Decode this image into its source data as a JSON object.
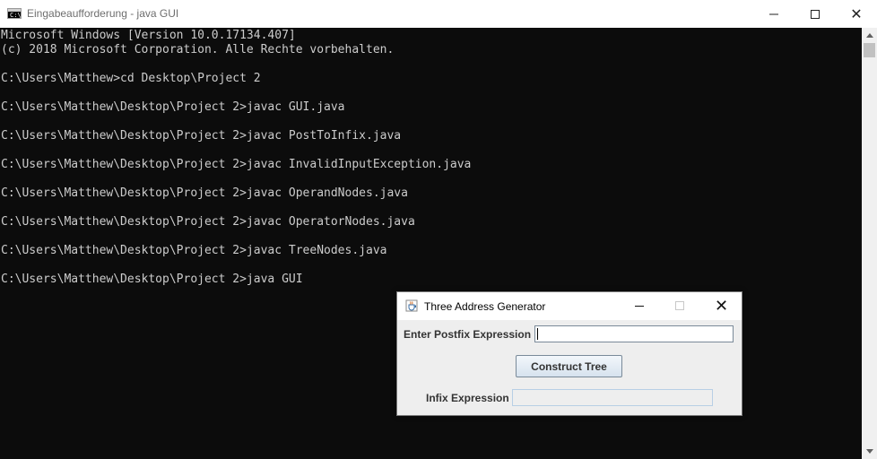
{
  "console_window": {
    "title": "Eingabeaufforderung - java  GUI",
    "lines": [
      "Microsoft Windows [Version 10.0.17134.407]",
      "(c) 2018 Microsoft Corporation. Alle Rechte vorbehalten.",
      "",
      "C:\\Users\\Matthew>cd Desktop\\Project 2",
      "",
      "C:\\Users\\Matthew\\Desktop\\Project 2>javac GUI.java",
      "",
      "C:\\Users\\Matthew\\Desktop\\Project 2>javac PostToInfix.java",
      "",
      "C:\\Users\\Matthew\\Desktop\\Project 2>javac InvalidInputException.java",
      "",
      "C:\\Users\\Matthew\\Desktop\\Project 2>javac OperandNodes.java",
      "",
      "C:\\Users\\Matthew\\Desktop\\Project 2>javac OperatorNodes.java",
      "",
      "C:\\Users\\Matthew\\Desktop\\Project 2>javac TreeNodes.java",
      "",
      "C:\\Users\\Matthew\\Desktop\\Project 2>java GUI"
    ],
    "colors": {
      "background": "#0c0c0c",
      "text": "#cccccc"
    }
  },
  "java_window": {
    "title": "Three Address Generator",
    "postfix_label": "Enter Postfix Expression",
    "postfix_value": "",
    "construct_button": "Construct Tree",
    "infix_label": "Infix Expression",
    "infix_value": ""
  },
  "icons": {
    "console": "command-prompt-icon",
    "java": "java-cup-icon",
    "minimize": "minimize-icon",
    "maximize": "maximize-icon",
    "close": "close-icon"
  }
}
